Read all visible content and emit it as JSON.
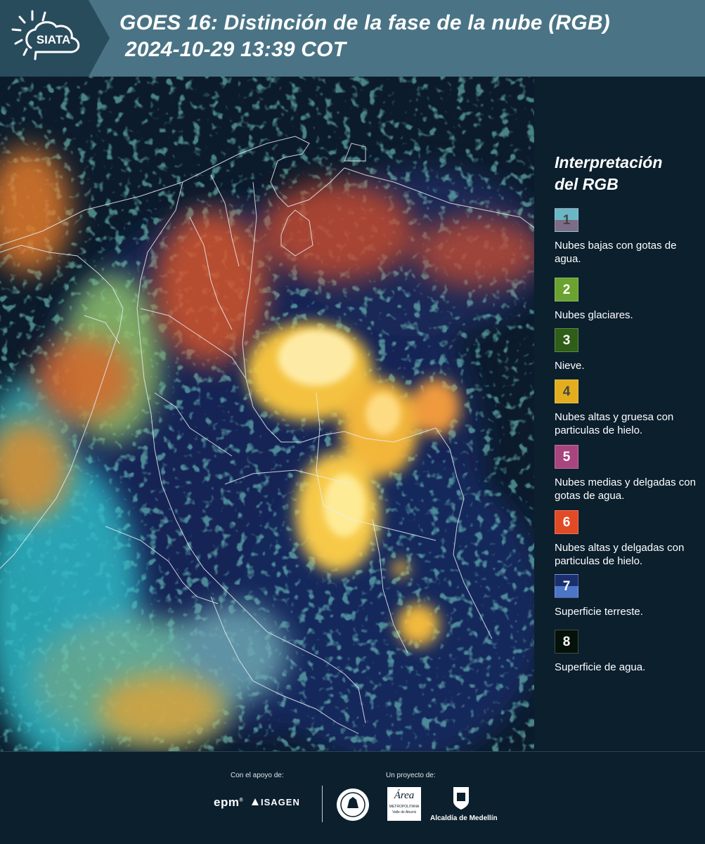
{
  "header": {
    "logo_text": "SIATA",
    "title_line1": "GOES 16: Distinción de la fase de la nube (RGB)",
    "title_line2": "2024-10-29 13:39 COT"
  },
  "legend": {
    "title_line1": "Interpretación",
    "title_line2": "del RGB",
    "items": [
      {
        "num": "1",
        "label": "Nubes bajas con gotas de agua.",
        "color_top": "#6bb7c6",
        "color_bottom": "#7b6d86",
        "num_color": "#444444"
      },
      {
        "num": "2",
        "label": "Nubes glaciares.",
        "color_top": "#6aa32f",
        "color_bottom": "#6aa32f",
        "num_color": "#ffffff"
      },
      {
        "num": "3",
        "label": "Nieve.",
        "color_top": "#2e5e17",
        "color_bottom": "#2e5e17",
        "num_color": "#ffffff"
      },
      {
        "num": "4",
        "label": "Nubes altas y gruesa con particulas de hielo.",
        "color_top": "#e3ad1e",
        "color_bottom": "#e3ad1e",
        "num_color": "#444444"
      },
      {
        "num": "5",
        "label": "Nubes medias y delgadas con gotas de agua.",
        "color_top": "#a8457f",
        "color_bottom": "#a8457f",
        "num_color": "#ffffff"
      },
      {
        "num": "6",
        "label": "Nubes altas y delgadas con particulas de hielo.",
        "color_top": "#e24a25",
        "color_bottom": "#e24a25",
        "num_color": "#ffffff"
      },
      {
        "num": "7",
        "label": "Superficie terreste.",
        "color_top": "#1a2f6e",
        "color_bottom": "#4c75c8",
        "num_color": "#ffffff"
      },
      {
        "num": "8",
        "label": "Superficie de agua.",
        "color_top": "#05120a",
        "color_bottom": "#05120a",
        "num_color": "#ffffff"
      }
    ]
  },
  "footer": {
    "support_label": "Con el apoyo de:",
    "project_label": "Un proyecto de:",
    "sponsors": [
      "epm",
      "ISAGEN"
    ],
    "partners": {
      "area_logo_text": "Área",
      "area_sub1": "METROPOLITANA",
      "area_sub2": "Valle de Aburrá",
      "alcaldia": "Alcaldía de Medellín"
    }
  }
}
